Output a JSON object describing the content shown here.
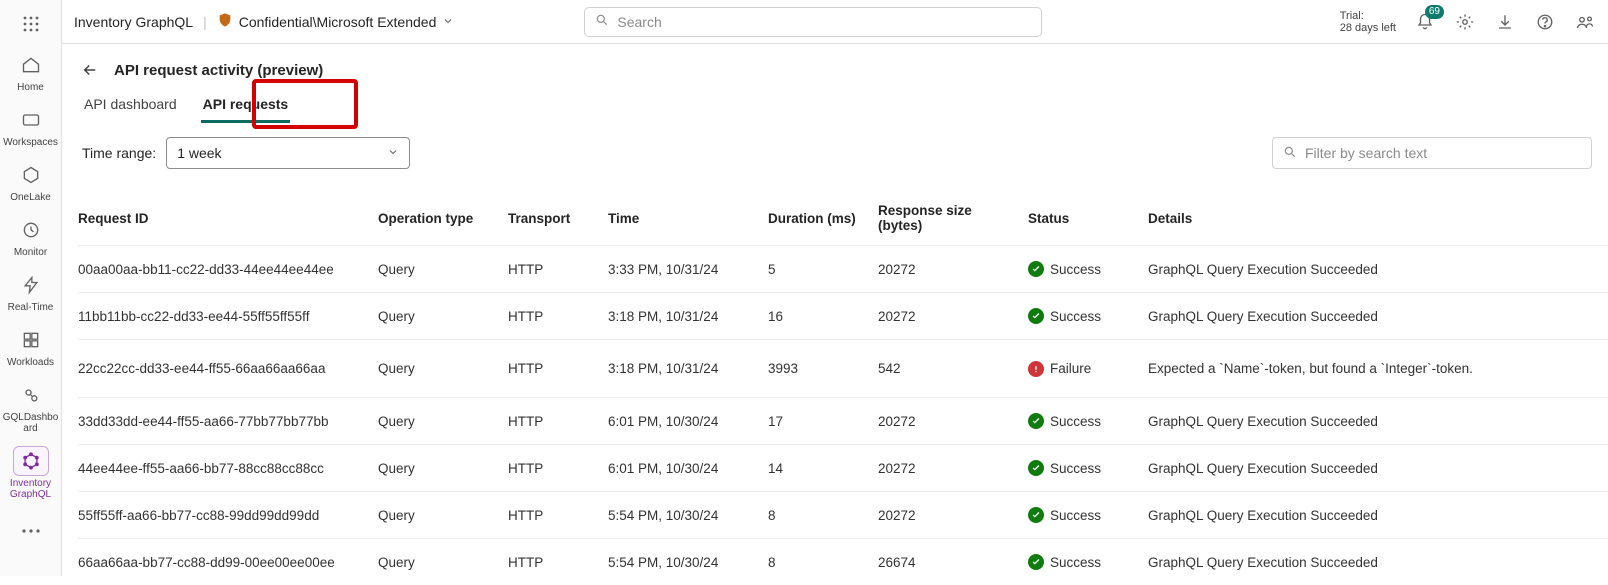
{
  "sidebar": {
    "items": [
      {
        "name": "home",
        "label": "Home"
      },
      {
        "name": "workspaces",
        "label": "Workspaces"
      },
      {
        "name": "onelake",
        "label": "OneLake"
      },
      {
        "name": "monitor",
        "label": "Monitor"
      },
      {
        "name": "realtime",
        "label": "Real-Time"
      },
      {
        "name": "workloads",
        "label": "Workloads"
      },
      {
        "name": "gqldashboard",
        "label": "GQLDashboard"
      },
      {
        "name": "inventory-graphql",
        "label": "Inventory GraphQL",
        "active": true
      }
    ]
  },
  "topbar": {
    "breadcrumb_item": "Inventory GraphQL",
    "sensitivity_label": "Confidential\\Microsoft Extended",
    "search_placeholder": "Search",
    "trial_label": "Trial:",
    "trial_remaining": "28 days left",
    "notification_badge": "69"
  },
  "page": {
    "title": "API request activity (preview)",
    "tabs": [
      {
        "id": "dashboard",
        "label": "API dashboard",
        "active": false
      },
      {
        "id": "requests",
        "label": "API requests",
        "active": true
      }
    ],
    "time_range_label": "Time range:",
    "time_range_value": "1 week",
    "filter_placeholder": "Filter by search text"
  },
  "table": {
    "columns": [
      "Request ID",
      "Operation type",
      "Transport",
      "Time",
      "Duration (ms)",
      "Response size (bytes)",
      "Status",
      "Details"
    ],
    "rows": [
      {
        "id": "00aa00aa-bb11-cc22-dd33-44ee44ee44ee",
        "op": "Query",
        "transport": "HTTP",
        "time": "3:33 PM, 10/31/24",
        "duration": "5",
        "size": "20272",
        "status": "Success",
        "details": "GraphQL Query Execution Succeeded"
      },
      {
        "id": "11bb11bb-cc22-dd33-ee44-55ff55ff55ff",
        "op": "Query",
        "transport": "HTTP",
        "time": "3:18 PM, 10/31/24",
        "duration": "16",
        "size": "20272",
        "status": "Success",
        "details": "GraphQL Query Execution Succeeded"
      },
      {
        "id": "22cc22cc-dd33-ee44-ff55-66aa66aa66aa",
        "op": "Query",
        "transport": "HTTP",
        "time": "3:18 PM, 10/31/24",
        "duration": "3993",
        "size": "542",
        "status": "Failure",
        "details": "Expected a `Name`-token, but found a `Integer`-token."
      },
      {
        "id": "33dd33dd-ee44-ff55-aa66-77bb77bb77bb",
        "op": "Query",
        "transport": "HTTP",
        "time": "6:01 PM, 10/30/24",
        "duration": "17",
        "size": "20272",
        "status": "Success",
        "details": "GraphQL Query Execution Succeeded"
      },
      {
        "id": "44ee44ee-ff55-aa66-bb77-88cc88cc88cc",
        "op": "Query",
        "transport": "HTTP",
        "time": "6:01 PM, 10/30/24",
        "duration": "14",
        "size": "20272",
        "status": "Success",
        "details": "GraphQL Query Execution Succeeded"
      },
      {
        "id": "55ff55ff-aa66-bb77-cc88-99dd99dd99dd",
        "op": "Query",
        "transport": "HTTP",
        "time": "5:54 PM, 10/30/24",
        "duration": "8",
        "size": "20272",
        "status": "Success",
        "details": "GraphQL Query Execution Succeeded"
      },
      {
        "id": "66aa66aa-bb77-cc88-dd99-00ee00ee00ee",
        "op": "Query",
        "transport": "HTTP",
        "time": "5:54 PM, 10/30/24",
        "duration": "8",
        "size": "26674",
        "status": "Success",
        "details": "GraphQL Query Execution Succeeded"
      }
    ]
  }
}
